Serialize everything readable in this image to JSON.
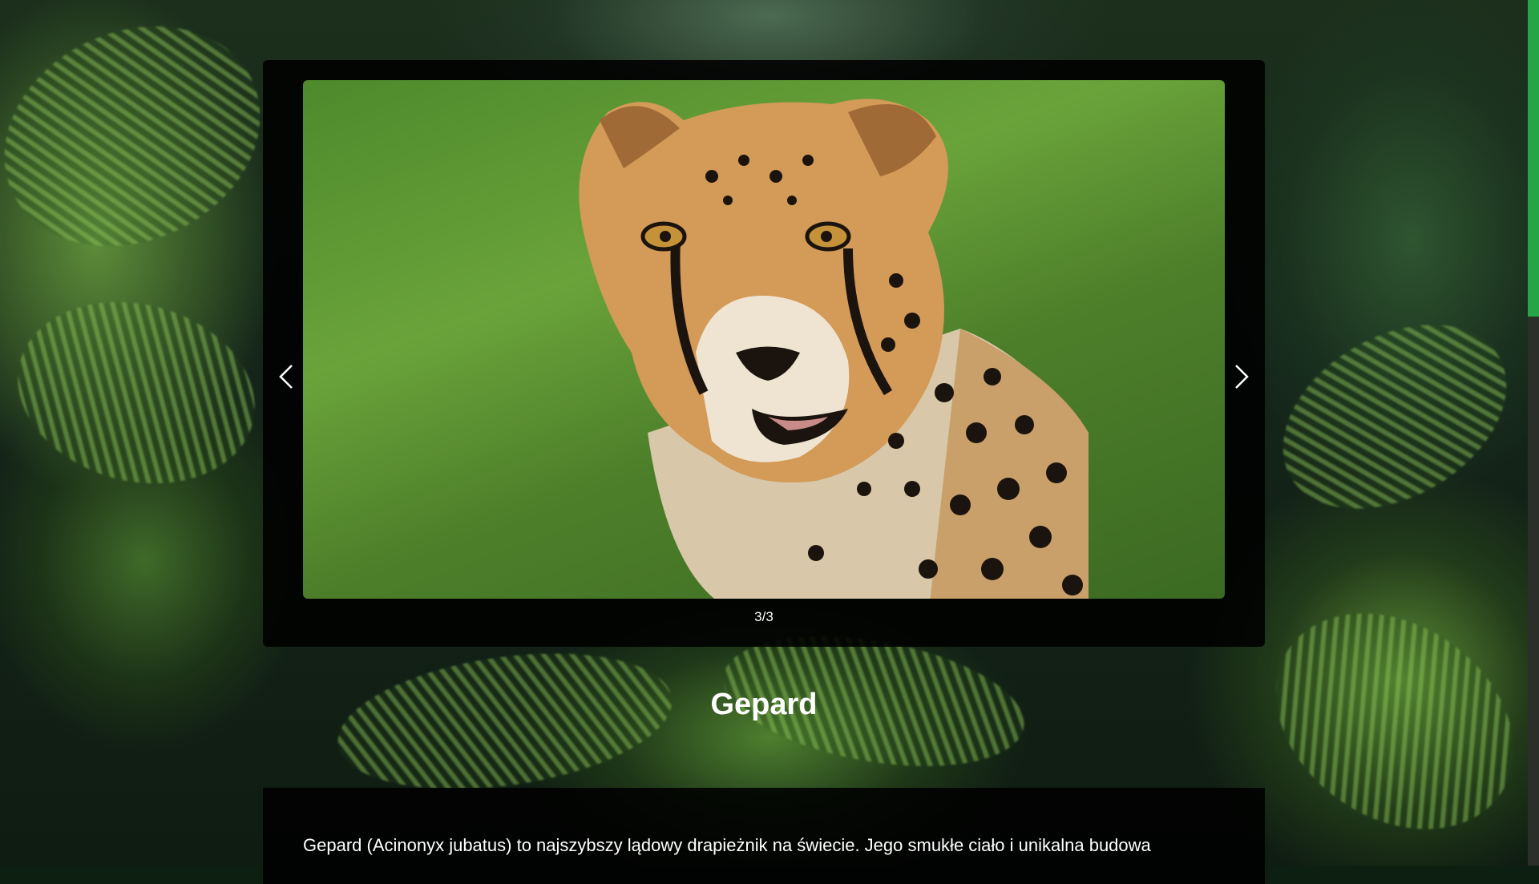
{
  "gallery": {
    "image_subject": "cheetah",
    "counter": "3/3",
    "prev_icon": "chevron-left-icon",
    "next_icon": "chevron-right-icon"
  },
  "animal": {
    "name": "Gepard",
    "description": "Gepard (Acinonyx jubatus) to najszybszy lądowy drapieżnik na świecie. Jego smukłe ciało i unikalna budowa"
  },
  "colors": {
    "scrollbar_thumb": "#26a546",
    "panel_bg": "#000000",
    "text": "#ffffff"
  }
}
